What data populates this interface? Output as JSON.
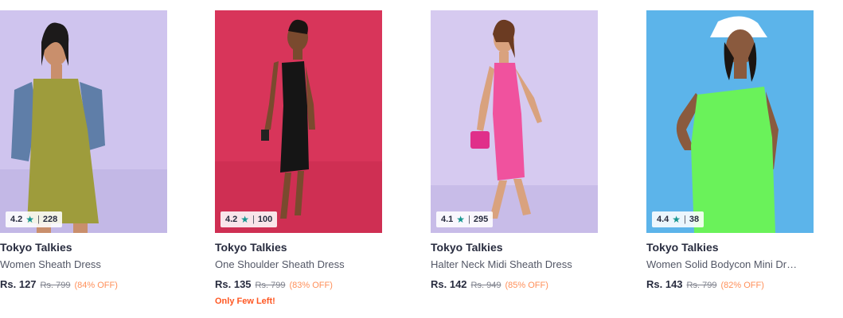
{
  "products": [
    {
      "brand": "Tokyo Talkies",
      "name": "Women Sheath Dress",
      "price": "Rs. 127",
      "mrp": "Rs. 799",
      "discount": "(84% OFF)",
      "rating": "4.2",
      "rating_count": "228",
      "bg_color": "#cfc4ee",
      "dress_color": "#9e9c3c"
    },
    {
      "brand": "Tokyo Talkies",
      "name": "One Shoulder Sheath Dress",
      "price": "Rs. 135",
      "mrp": "Rs. 799",
      "discount": "(83% OFF)",
      "rating": "4.2",
      "rating_count": "100",
      "stock_note": "Only Few Left!",
      "bg_color": "#d8355a",
      "dress_color": "#151515"
    },
    {
      "brand": "Tokyo Talkies",
      "name": "Halter Neck Midi Sheath Dress",
      "price": "Rs. 142",
      "mrp": "Rs. 949",
      "discount": "(85% OFF)",
      "rating": "4.1",
      "rating_count": "295",
      "bg_color": "#d6caf0",
      "dress_color": "#f0529e"
    },
    {
      "brand": "Tokyo Talkies",
      "name": "Women Solid Bodycon Mini Dress",
      "price": "Rs. 143",
      "mrp": "Rs. 799",
      "discount": "(82% OFF)",
      "rating": "4.4",
      "rating_count": "38",
      "bg_color": "#5cb4ea",
      "dress_color": "#6af25a"
    }
  ],
  "colors": {
    "rating_star": "#14958f",
    "discount": "#ff905a",
    "stock_note": "#ff5722"
  }
}
